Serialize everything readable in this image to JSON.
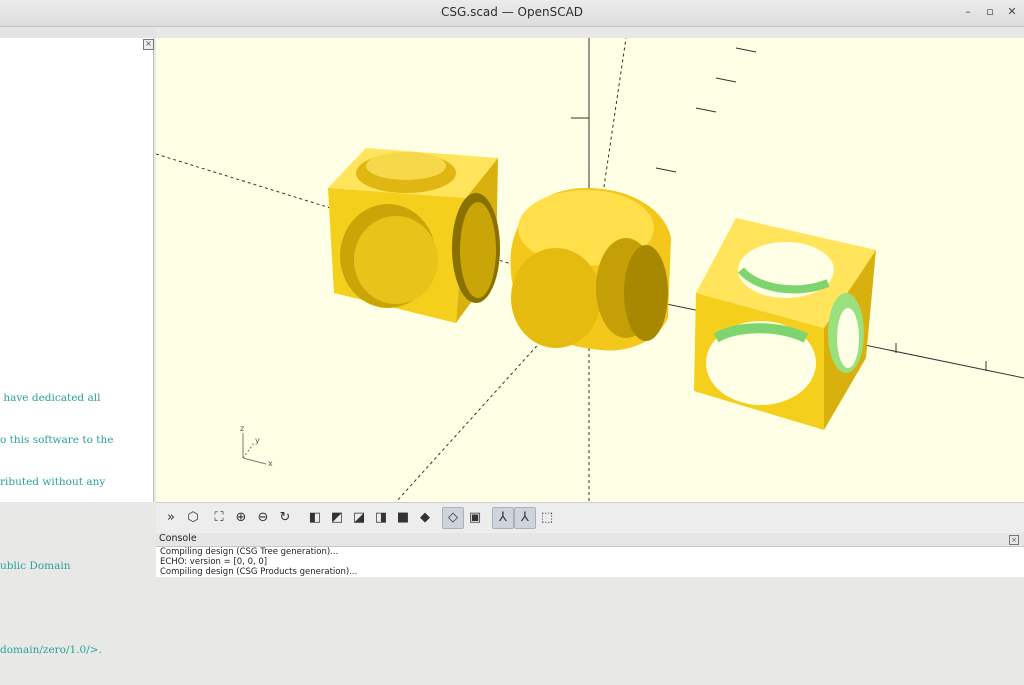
{
  "window": {
    "title": "CSG.scad — OpenSCAD",
    "min": "–",
    "max": "▫",
    "close": "✕"
  },
  "editor": {
    "lines": [
      " have dedicated all",
      "o this software to the",
      "ributed without any",
      "",
      "ublic Domain",
      "",
      "domain/zero/1.0/>."
    ]
  },
  "toolbar": {
    "buttons": [
      {
        "name": "preview-button",
        "icon": "»"
      },
      {
        "name": "render-button",
        "icon": "⬡"
      },
      {
        "name": "view-all-button",
        "icon": "⛶"
      },
      {
        "name": "zoom-in-button",
        "icon": "⊕"
      },
      {
        "name": "zoom-out-button",
        "icon": "⊖"
      },
      {
        "name": "reset-view-button",
        "icon": "↻"
      },
      {
        "name": "view-right-button",
        "icon": "◧"
      },
      {
        "name": "view-top-button",
        "icon": "◩"
      },
      {
        "name": "view-bottom-button",
        "icon": "◪"
      },
      {
        "name": "view-left-button",
        "icon": "◨"
      },
      {
        "name": "view-front-button",
        "icon": "■"
      },
      {
        "name": "view-back-button",
        "icon": "◆"
      },
      {
        "name": "perspective-button",
        "icon": "◇"
      },
      {
        "name": "orthogonal-button",
        "icon": "▣"
      },
      {
        "name": "show-axes-button",
        "icon": "⅄"
      },
      {
        "name": "show-scale-button",
        "icon": "⅄"
      },
      {
        "name": "show-edges-button",
        "icon": "⬚"
      }
    ]
  },
  "console": {
    "label": "Console",
    "lines": [
      "Compiling design (CSG Tree generation)...",
      "ECHO: version = [0, 0, 0]",
      "Compiling design (CSG Products generation)..."
    ]
  },
  "axes_indicator": {
    "x": "x",
    "y": "y",
    "z": "z"
  },
  "colors": {
    "background": "#ffffe5",
    "object": "#f5d020",
    "shadow": "#c9a508",
    "inner": "#7ed56f"
  }
}
